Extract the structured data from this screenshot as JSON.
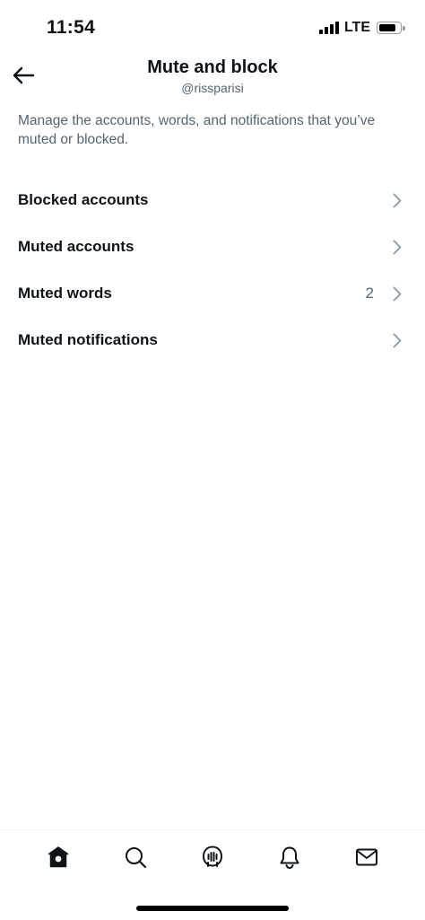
{
  "status_bar": {
    "time": "11:54",
    "network": "LTE"
  },
  "header": {
    "title": "Mute and block",
    "subtitle": "@rissparisi",
    "back_icon": "arrow-left-icon"
  },
  "description": "Manage the accounts, words, and notifications that you’ve muted or blocked.",
  "menu": {
    "items": [
      {
        "label": "Blocked accounts",
        "count": ""
      },
      {
        "label": "Muted accounts",
        "count": ""
      },
      {
        "label": "Muted words",
        "count": "2"
      },
      {
        "label": "Muted notifications",
        "count": ""
      }
    ]
  },
  "tab_bar": {
    "tabs": [
      {
        "icon": "home-icon",
        "active": true
      },
      {
        "icon": "search-icon",
        "active": false
      },
      {
        "icon": "spaces-icon",
        "active": false
      },
      {
        "icon": "bell-icon",
        "active": false
      },
      {
        "icon": "mail-icon",
        "active": false
      }
    ]
  },
  "colors": {
    "text_primary": "#0f1419",
    "text_secondary": "#536471",
    "chevron": "#8b98a5",
    "divider": "#eff3f4"
  }
}
